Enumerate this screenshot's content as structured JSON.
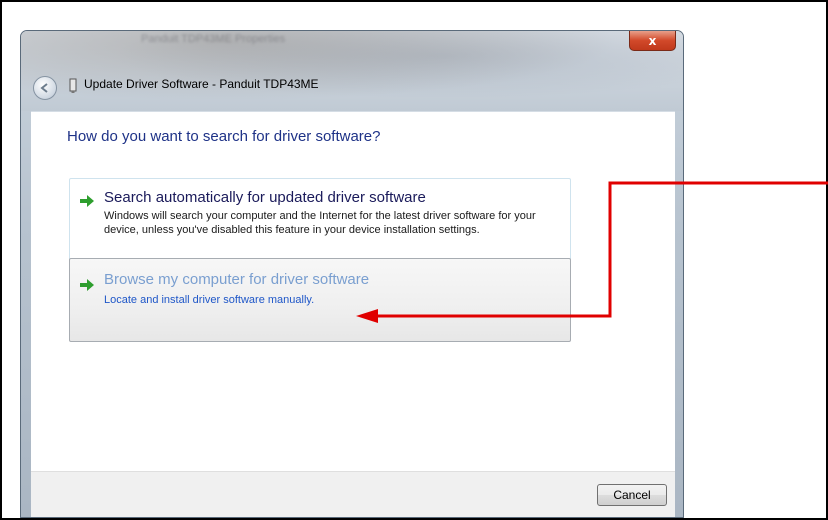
{
  "window": {
    "background_title": "Panduit TDP43ME Properties",
    "close_glyph": "x",
    "title": "Update Driver Software - Panduit TDP43ME"
  },
  "main": {
    "heading": "How do you want to search for driver software?",
    "options": [
      {
        "title": "Search automatically for updated driver software",
        "description": "Windows will search your computer and the Internet for the latest driver software for your device, unless you've disabled this feature in your device installation settings."
      },
      {
        "title": "Browse my computer for driver software",
        "description": "Locate and install driver software manually."
      }
    ]
  },
  "footer": {
    "cancel_label": "Cancel"
  },
  "colors": {
    "heading": "#1e3287",
    "link": "#1f57c8",
    "arrow_green": "#2e9e2e",
    "annotation_red": "#e00000",
    "close_red": "#c0391c"
  },
  "icons": {
    "back": "back-arrow-icon",
    "device": "device-icon",
    "option_arrow": "green-arrow-icon"
  }
}
